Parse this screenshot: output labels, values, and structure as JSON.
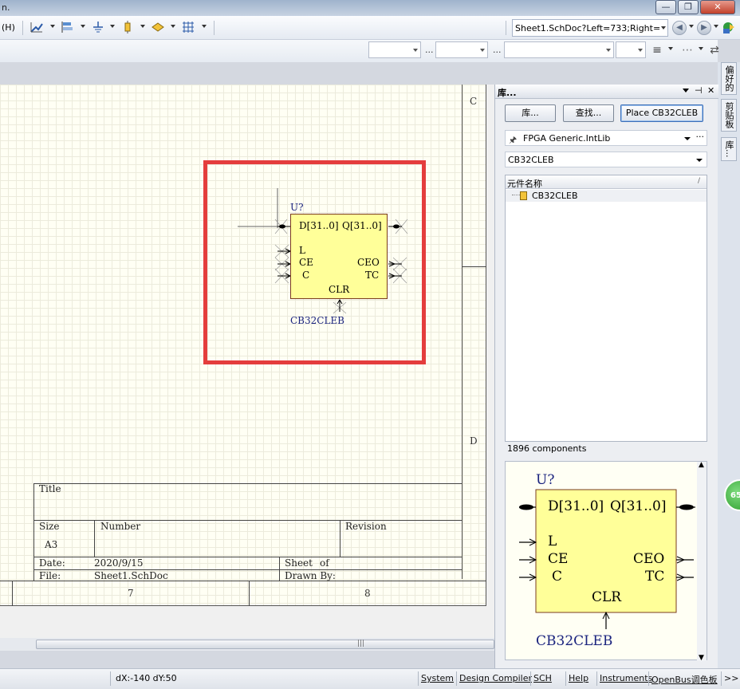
{
  "window": {
    "title_fragment": "n.",
    "btn_min": "—",
    "btn_max": "❐",
    "btn_close": "✕"
  },
  "toolbar": {
    "menu_h": "(H)",
    "address": "Sheet1.SchDoc?Left=733;Right=",
    "dots1": "...",
    "dots2": "...",
    "dots3": "..."
  },
  "side_tabs": [
    "偏好的",
    "剪贴板",
    "库..."
  ],
  "sheet": {
    "zone_c": "C",
    "zone_d": "D",
    "col_7": "7",
    "col_8": "8",
    "title_block": {
      "title": "Title",
      "size_label": "Size",
      "size_value": "A3",
      "number_label": "Number",
      "revision_label": "Revision",
      "date_label": "Date:",
      "date_value": "2020/9/15",
      "file_label": "File:",
      "file_value": "Sheet1.SchDoc",
      "sheet_label": "Sheet",
      "of_label": "of",
      "drawn_label": "Drawn By:"
    }
  },
  "component": {
    "designator": "U?",
    "comment": "CB32CLEB",
    "pins": {
      "d": "D[31..0]",
      "q": "Q[31..0]",
      "l": "L",
      "ce": "CE",
      "c": "C",
      "ceo": "CEO",
      "tc": "TC",
      "clr": "CLR"
    }
  },
  "library_panel": {
    "title": "库...",
    "pin_icon": "⊣",
    "close_icon": "✕",
    "buttons": {
      "libraries": "库...",
      "search": "查找...",
      "place": "Place CB32CLEB"
    },
    "library_name": "FPGA Generic.IntLib",
    "more_icon": "···",
    "filter_value": "CB32CLEB",
    "column_header": "元件名称",
    "sort_icon": "/",
    "components": [
      "CB32CLEB"
    ],
    "count": "1896 components"
  },
  "status": {
    "coords": "dX:-140 dY:50",
    "items": [
      "System",
      "Design Compiler",
      "SCH",
      "Help",
      "Instruments",
      "OpenBus调色板"
    ],
    "more": ">>"
  },
  "badge": "65",
  "colors": {
    "highlight": "#e43d3d",
    "component_fill": "#ffff99",
    "designator": "#1a237e",
    "sheet_bg": "#fffff4"
  }
}
